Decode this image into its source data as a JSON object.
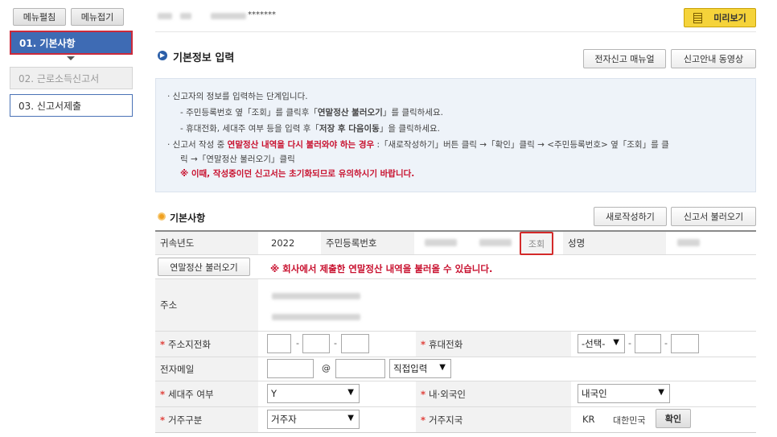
{
  "sidebar": {
    "menu_open_label": "메뉴펼침",
    "menu_close_label": "메뉴접기",
    "items": [
      {
        "label": "01. 기본사항"
      },
      {
        "label": "02. 근로소득신고서"
      },
      {
        "label": "03. 신고서제출"
      }
    ]
  },
  "header": {
    "masked_id": "*******",
    "preview_label": "미리보기"
  },
  "section1": {
    "title": "기본정보 입력",
    "manual_button": "전자신고 매뉴얼",
    "video_button": "신고안내 동영상"
  },
  "info": {
    "line1": "· 신고자의 정보를 입력하는 단계입니다.",
    "line2_pre": "- 주민등록번호 옆「조회」를 클릭후「",
    "line2_bold": "연말정산 불러오기",
    "line2_post": "」를 클릭하세요.",
    "line3_pre": "- 휴대전화, 세대주 여부 등을 입력 후「",
    "line3_bold": "저장 후 다음이동",
    "line3_post": "」을 클릭하세요.",
    "line4_pre": "· 신고서 작성 중 ",
    "line4_red": "연말정산 내역을 다시 불러와야 하는 경우",
    "line4_post": " :「새로작성하기」버튼 클릭 →「확인」클릭 → <주민등록번호> 옆「조회」를 클",
    "line5": "릭 →「연말정산 불러오기」클릭",
    "line6": "※ 이때, 작성중이던 신고서는 초기화되므로 유의하시기 바랍니다."
  },
  "section2": {
    "title": "기본사항",
    "rewrite_button": "새로작성하기",
    "load_button": "신고서 불러오기"
  },
  "form": {
    "year_label": "귀속년도",
    "year_value": "2022",
    "rrn_label": "주민등록번호",
    "lookup_button": "조회",
    "name_label": "성명",
    "load_yearend_button": "연말정산 불러오기",
    "load_notice": "※ 회사에서 제출한 연말정산 내역을 불러올 수 있습니다.",
    "address_label": "주소",
    "home_phone_label": "주소지전화",
    "mobile_label": "휴대전화",
    "mobile_select": "-선택-",
    "email_label": "전자메일",
    "email_at": "@",
    "email_domain_select": "직접입력",
    "householder_label": "세대주 여부",
    "householder_value": "Y",
    "nationality_label": "내·외국인",
    "nationality_value": "내국인",
    "residence_label": "거주구분",
    "residence_value": "거주자",
    "region_label": "거주지국",
    "region_code": "KR",
    "region_name": "대한민국",
    "confirm_button": "확인",
    "required_mark": "*"
  },
  "colors": {
    "nav_active_bg": "#3e6bb4",
    "highlight_red": "#c8102e",
    "preview_bg": "#f5d33a",
    "info_bg": "#eef3f9"
  }
}
